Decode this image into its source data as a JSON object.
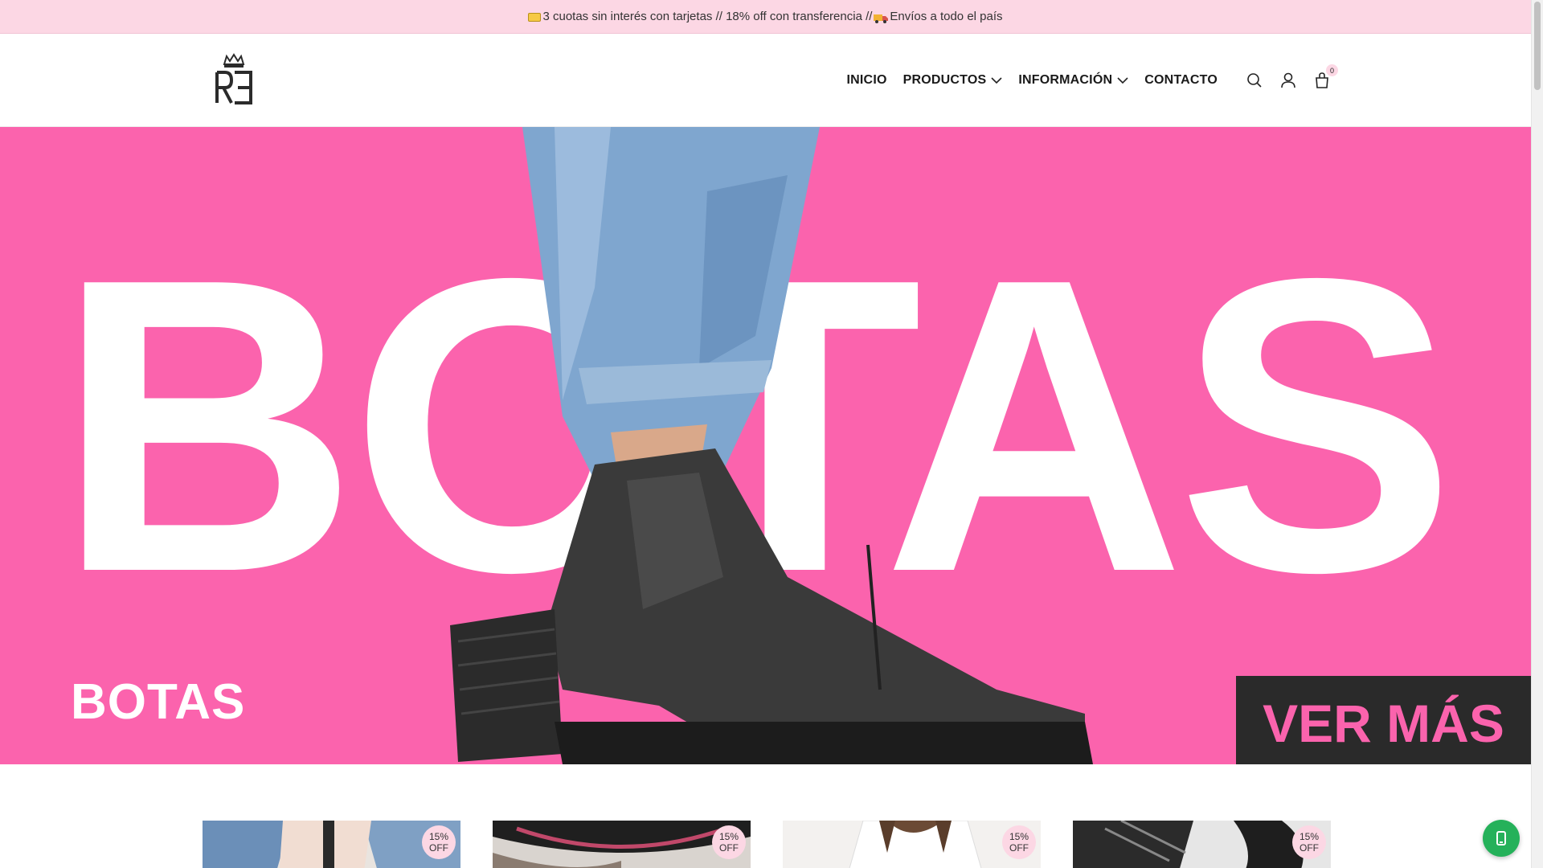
{
  "announcement": {
    "part1": "3 cuotas sin interés con tarjetas // 18% off con transferencia //",
    "part2": " Envíos a todo el país",
    "card_icon": "credit-card-icon",
    "truck_icon": "delivery-truck-icon"
  },
  "header": {
    "logo_text": "RE",
    "nav": [
      {
        "label": "INICIO",
        "has_dropdown": false
      },
      {
        "label": "PRODUCTOS",
        "has_dropdown": true
      },
      {
        "label": "INFORMACIÓN",
        "has_dropdown": true
      },
      {
        "label": "CONTACTO",
        "has_dropdown": false
      }
    ],
    "icons": [
      "search-icon",
      "user-icon",
      "cart-icon"
    ],
    "cart_count": "0"
  },
  "hero": {
    "big_word": "BOTAS",
    "small_label": "BOTAS",
    "cta": "VER MÁS",
    "bg_color": "#fb63ad"
  },
  "products": [
    {
      "badge_pct": "15%",
      "badge_off": "OFF"
    },
    {
      "badge_pct": "15%",
      "badge_off": "OFF"
    },
    {
      "badge_pct": "15%",
      "badge_off": "OFF"
    },
    {
      "badge_pct": "15%",
      "badge_off": "OFF"
    }
  ],
  "colors": {
    "announcement_bg": "#fcd7e4",
    "accent_pink": "#fb63ad",
    "whatsapp_green": "#25b15a"
  }
}
